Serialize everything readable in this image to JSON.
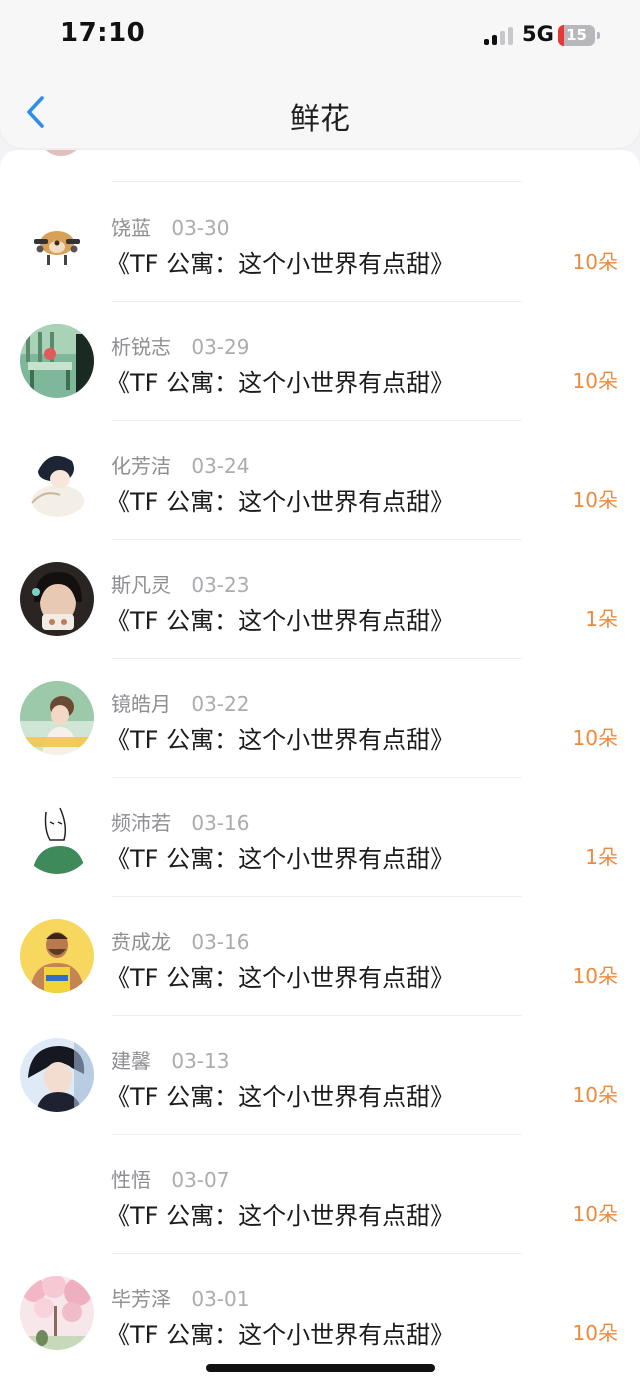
{
  "status_bar": {
    "time": "17:10",
    "network": "5G",
    "battery": "15",
    "battery_level_pct": 15,
    "signal_bars_active": 2,
    "signal_bars_total": 4
  },
  "header": {
    "title": "鲜花",
    "back_icon": "chevron-left-icon"
  },
  "colors": {
    "accent_blue": "#2f8fe6",
    "count_orange": "#ee8a3c",
    "name_gray": "#8e8e93",
    "battery_red": "#e53935"
  },
  "flowers": [
    {
      "name": "饶蓝",
      "date": "03-30",
      "title": "《TF 公寓：这个小世界有点甜》",
      "count": "10朵"
    },
    {
      "name": "析锐志",
      "date": "03-29",
      "title": "《TF 公寓：这个小世界有点甜》",
      "count": "10朵"
    },
    {
      "name": "化芳洁",
      "date": "03-24",
      "title": "《TF 公寓：这个小世界有点甜》",
      "count": "10朵"
    },
    {
      "name": "斯凡灵",
      "date": "03-23",
      "title": "《TF 公寓：这个小世界有点甜》",
      "count": "1朵"
    },
    {
      "name": "镜皓月",
      "date": "03-22",
      "title": "《TF 公寓：这个小世界有点甜》",
      "count": "10朵"
    },
    {
      "name": "频沛若",
      "date": "03-16",
      "title": "《TF 公寓：这个小世界有点甜》",
      "count": "1朵"
    },
    {
      "name": "贲成龙",
      "date": "03-16",
      "title": "《TF 公寓：这个小世界有点甜》",
      "count": "10朵"
    },
    {
      "name": "建馨",
      "date": "03-13",
      "title": "《TF 公寓：这个小世界有点甜》",
      "count": "10朵"
    },
    {
      "name": "性悟",
      "date": "03-07",
      "title": "《TF 公寓：这个小世界有点甜》",
      "count": "10朵"
    },
    {
      "name": "毕芳泽",
      "date": "03-01",
      "title": "《TF 公寓：这个小世界有点甜》",
      "count": "10朵"
    }
  ]
}
